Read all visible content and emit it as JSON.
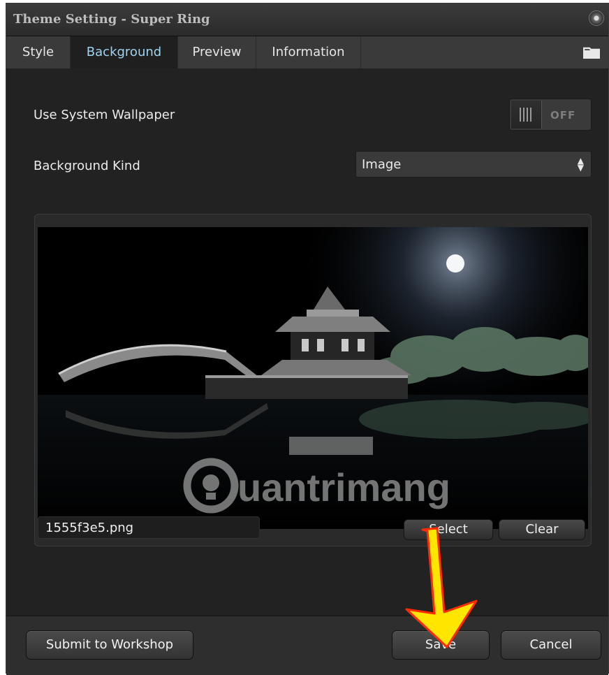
{
  "window": {
    "title": "Theme Setting - Super Ring"
  },
  "tabs": [
    {
      "label": "Style",
      "active": false
    },
    {
      "label": "Background",
      "active": true
    },
    {
      "label": "Preview",
      "active": false
    },
    {
      "label": "Information",
      "active": false
    }
  ],
  "icons": {
    "close": "circle-button-icon",
    "folder": "folder-icon"
  },
  "settings": {
    "use_system_wallpaper": {
      "label": "Use System Wallpaper",
      "state": "OFF"
    },
    "background_kind": {
      "label": "Background Kind",
      "value": "Image"
    }
  },
  "image_panel": {
    "filename": "1555f3e5.png",
    "watermark": "uantrimang",
    "select_label": "Select",
    "clear_label": "Clear"
  },
  "footer": {
    "submit_label": "Submit to Workshop",
    "save_label": "Save",
    "cancel_label": "Cancel"
  },
  "colors": {
    "active_tab_text": "#9fd3ef",
    "annotation_arrow": "#ffe600",
    "annotation_arrow_outline": "#ff2a00"
  }
}
